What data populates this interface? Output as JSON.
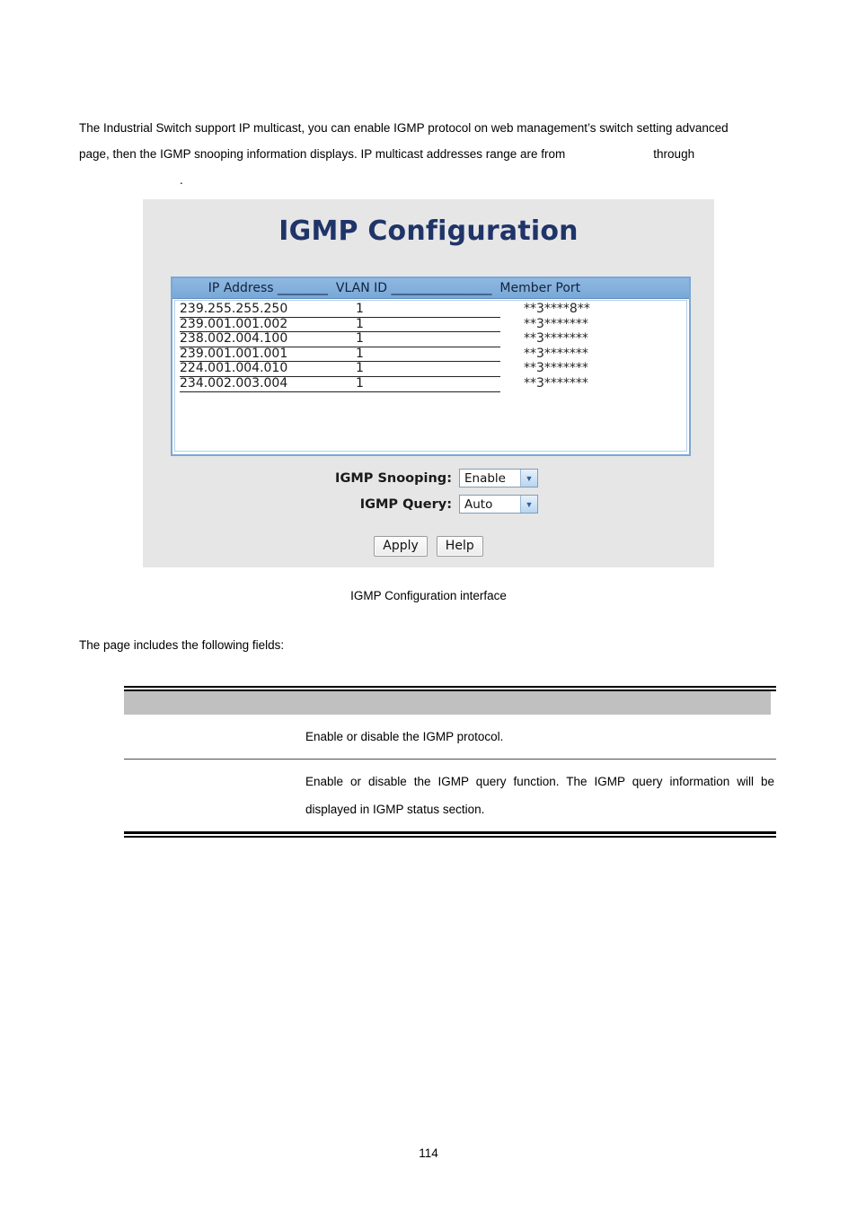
{
  "document": {
    "page_number": "114",
    "intro_line_1": "The Industrial Switch support IP multicast, you can enable IGMP protocol on web management’s switch setting advanced",
    "intro_line_2_a": "page, then the IGMP snooping information displays. IP multicast addresses range are from",
    "intro_line_2_b": "through",
    "intro_line_3": ".",
    "figure_caption": "IGMP Configuration interface",
    "lead_in": "The page includes the following fields:"
  },
  "screenshot": {
    "title": "IGMP Configuration",
    "list_header": "    IP Address ________  VLAN ID ________________  Member Port",
    "columns": [
      "IP Address",
      "VLAN ID",
      "Member Port"
    ],
    "rows": [
      {
        "ip": "239.255.255.250",
        "vlan": "1",
        "member_port": "**3****8**"
      },
      {
        "ip": "239.001.001.002",
        "vlan": "1",
        "member_port": "**3*******"
      },
      {
        "ip": "238.002.004.100",
        "vlan": "1",
        "member_port": "**3*******"
      },
      {
        "ip": "239.001.001.001",
        "vlan": "1",
        "member_port": "**3*******"
      },
      {
        "ip": "224.001.004.010",
        "vlan": "1",
        "member_port": "**3*******"
      },
      {
        "ip": "234.002.003.004",
        "vlan": "1",
        "member_port": "**3*******"
      }
    ],
    "form": {
      "snooping_label": "IGMP Snooping:",
      "snooping_value": "Enable",
      "query_label": "IGMP Query:",
      "query_value": "Auto"
    },
    "buttons": {
      "apply": "Apply",
      "help": "Help"
    },
    "colors": {
      "panel_bg": "#e6e6e6",
      "title": "#1f3468",
      "list_header_bg": "#79a8d8",
      "list_border": "#7ba7d7",
      "dropdown_arrow": "#2b5f9e"
    }
  },
  "fields_table": {
    "header": {
      "col1": "",
      "col2": ""
    },
    "rows": [
      {
        "name": "",
        "description_line_1": "Enable or disable the IGMP protocol.",
        "description_line_2": ""
      },
      {
        "name": "",
        "description_line_1": "Enable or disable the IGMP query function. The IGMP query information will be",
        "description_line_2": "displayed in IGMP status section."
      }
    ]
  }
}
